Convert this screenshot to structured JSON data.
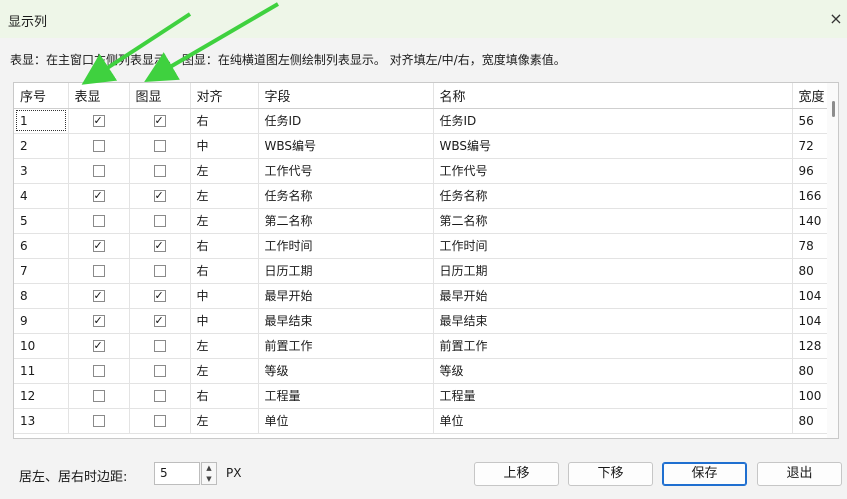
{
  "window": {
    "title": "显示列",
    "close_glyph": "×"
  },
  "hint": "表显：在主窗口左侧列表显示。 图显：在纯横道图左侧绘制列表显示。 对齐填左/中/右，宽度填像素值。",
  "table": {
    "headers": [
      "序号",
      "表显",
      "图显",
      "对齐",
      "字段",
      "名称",
      "宽度"
    ],
    "rows": [
      {
        "seq": "1",
        "table_show": true,
        "chart_show": true,
        "align": "右",
        "field": "任务ID",
        "name": "任务ID",
        "width": "56"
      },
      {
        "seq": "2",
        "table_show": false,
        "chart_show": false,
        "align": "中",
        "field": "WBS编号",
        "name": "WBS编号",
        "width": "72"
      },
      {
        "seq": "3",
        "table_show": false,
        "chart_show": false,
        "align": "左",
        "field": "工作代号",
        "name": "工作代号",
        "width": "96"
      },
      {
        "seq": "4",
        "table_show": true,
        "chart_show": true,
        "align": "左",
        "field": "任务名称",
        "name": "任务名称",
        "width": "166"
      },
      {
        "seq": "5",
        "table_show": false,
        "chart_show": false,
        "align": "左",
        "field": "第二名称",
        "name": "第二名称",
        "width": "140"
      },
      {
        "seq": "6",
        "table_show": true,
        "chart_show": true,
        "align": "右",
        "field": "工作时间",
        "name": "工作时间",
        "width": "78"
      },
      {
        "seq": "7",
        "table_show": false,
        "chart_show": false,
        "align": "右",
        "field": "日历工期",
        "name": "日历工期",
        "width": "80"
      },
      {
        "seq": "8",
        "table_show": true,
        "chart_show": true,
        "align": "中",
        "field": "最早开始",
        "name": "最早开始",
        "width": "104"
      },
      {
        "seq": "9",
        "table_show": true,
        "chart_show": true,
        "align": "中",
        "field": "最早结束",
        "name": "最早结束",
        "width": "104"
      },
      {
        "seq": "10",
        "table_show": true,
        "chart_show": false,
        "align": "左",
        "field": "前置工作",
        "name": "前置工作",
        "width": "128"
      },
      {
        "seq": "11",
        "table_show": false,
        "chart_show": false,
        "align": "左",
        "field": "等级",
        "name": "等级",
        "width": "80"
      },
      {
        "seq": "12",
        "table_show": false,
        "chart_show": false,
        "align": "右",
        "field": "工程量",
        "name": "工程量",
        "width": "100"
      },
      {
        "seq": "13",
        "table_show": false,
        "chart_show": false,
        "align": "左",
        "field": "单位",
        "name": "单位",
        "width": "80"
      }
    ]
  },
  "margin": {
    "label": "居左、居右时边距:",
    "value": "5",
    "unit": "PX"
  },
  "buttons": {
    "move_up": "上移",
    "move_down": "下移",
    "save": "保存",
    "exit": "退出"
  },
  "colors": {
    "title_bg": "#eef6e8",
    "arrow": "#3fd13f",
    "primary_border": "#1f6fd0"
  },
  "icons": {
    "close": "close-icon",
    "spin_up": "chevron-up-icon",
    "spin_down": "chevron-down-icon",
    "checkbox": "checkbox-icon"
  }
}
